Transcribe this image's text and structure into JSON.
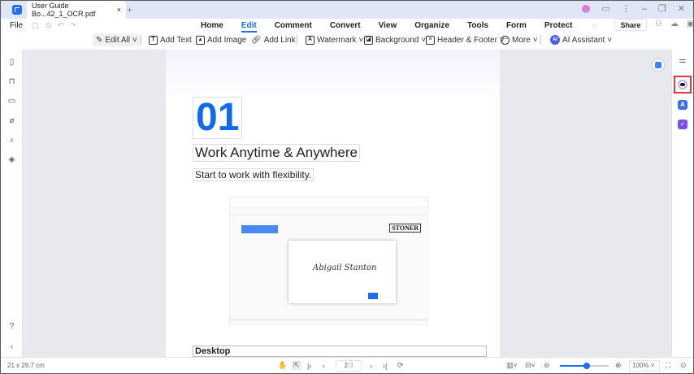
{
  "titlebar": {
    "tab_title": "User Guide Bo...42_1_OCR.pdf",
    "close": "×",
    "new_tab": "+"
  },
  "menu": {
    "file": "File",
    "tabs": [
      "Home",
      "Edit",
      "Comment",
      "Convert",
      "View",
      "Organize",
      "Tools",
      "Form",
      "Protect"
    ],
    "active_tab": "Edit",
    "share": "Share"
  },
  "toolbar": {
    "edit_all": "Edit All",
    "add_text": "Add Text",
    "add_image": "Add Image",
    "add_link": "Add Link",
    "watermark": "Watermark",
    "background": "Background",
    "header_footer": "Header & Footer",
    "more": "More",
    "ai_assistant": "AI Assistant"
  },
  "page": {
    "number": "01",
    "heading": "Work Anytime & Anywhere",
    "subheading": "Start to work with flexibility.",
    "section": "Desktop",
    "embedded": {
      "brand": "STONER",
      "signature": "Abigail Stanton"
    }
  },
  "status": {
    "page_size": "21 x 29.7 cm",
    "page_input": "2",
    "page_total": "/3",
    "zoom": "100%",
    "zoom_level": 0.55
  },
  "colors": {
    "accent": "#1f6cf0",
    "highlight_box": "#e53935"
  }
}
